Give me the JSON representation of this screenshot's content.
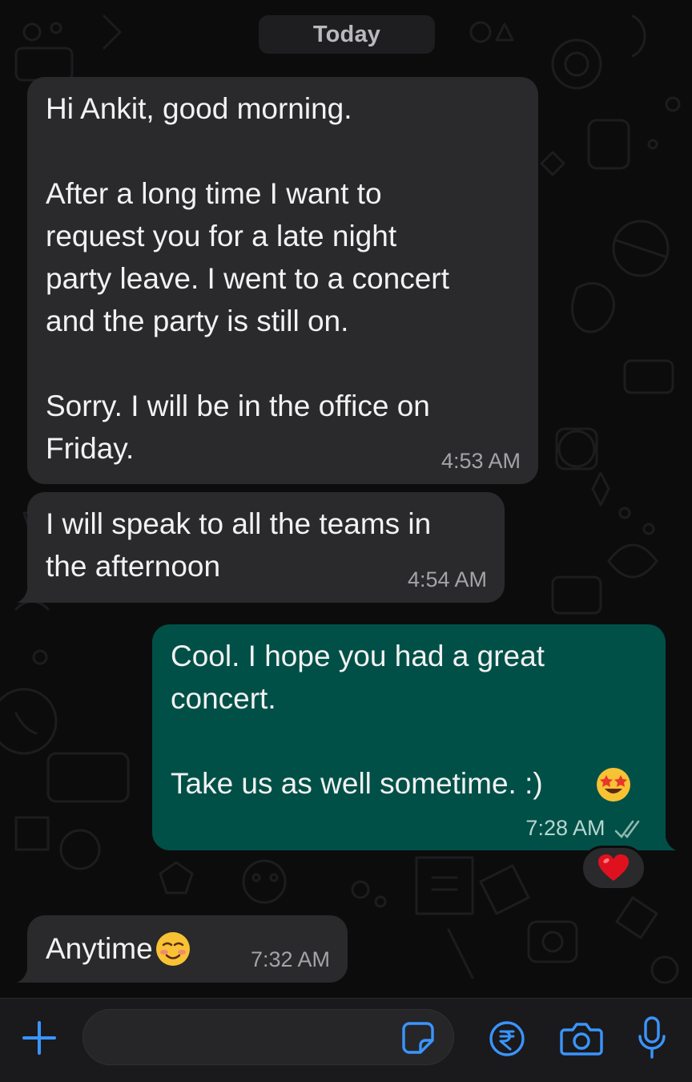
{
  "colors": {
    "background": "#0c0c0d",
    "incoming_bubble": "#2a2a2c",
    "outgoing_bubble": "#005048",
    "accent_blue": "#3a95ff",
    "heart_red": "#e0111f"
  },
  "date_divider": "Today",
  "messages": [
    {
      "direction": "incoming",
      "text": "Hi Ankit, good morning.\n\nAfter a long time I want to\nrequest you for a late night\nparty leave. I went to a concert\nand the party is still on.\n\nSorry. I will be in the office on\nFriday.",
      "time": "4:53 AM"
    },
    {
      "direction": "incoming",
      "text": "I will speak to all the teams in\nthe afternoon",
      "time": "4:54 AM"
    },
    {
      "direction": "outgoing",
      "text": "Cool. I hope you had a great\nconcert.\n\nTake us as well sometime. :)",
      "emoji": "star-struck-emoji",
      "time": "7:28 AM",
      "status": "read-double-check-icon",
      "reaction": "red-heart-emoji"
    },
    {
      "direction": "incoming",
      "text": "Anytime",
      "emoji": "smiling-face-emoji",
      "time": "7:32 AM"
    }
  ],
  "composer": {
    "attach_icon": "plus-icon",
    "input_value": "",
    "sticker_icon": "sticker-icon",
    "payment_icon": "rupee-icon",
    "camera_icon": "camera-icon",
    "mic_icon": "microphone-icon"
  }
}
